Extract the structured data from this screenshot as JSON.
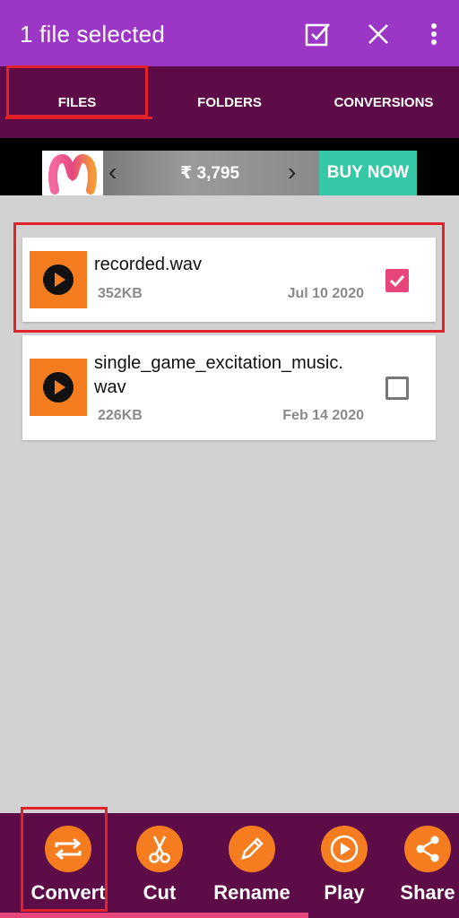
{
  "topbar": {
    "title": "1 file selected",
    "actions": [
      "select-all-icon",
      "close-icon",
      "more-vert-icon"
    ]
  },
  "tabs": [
    {
      "label": "FILES",
      "selected": true
    },
    {
      "label": "FOLDERS"
    },
    {
      "label": "CONVERSIONS"
    }
  ],
  "ad": {
    "price": "₹ 3,795",
    "cta": "BUY NOW"
  },
  "files": [
    {
      "name": "recorded.wav",
      "size": "352KB",
      "date": "Jul 10 2020",
      "checked": true
    },
    {
      "name_line1": "single_game_excitation_music.",
      "name_line2": "wav",
      "size": "226KB",
      "date": "Feb 14 2020",
      "checked": false
    }
  ],
  "bottom_actions": [
    {
      "label": "Convert",
      "icon": "convert-icon"
    },
    {
      "label": "Cut",
      "icon": "scissors-icon"
    },
    {
      "label": "Rename",
      "icon": "pencil-icon"
    },
    {
      "label": "Play",
      "icon": "play-circle-icon"
    },
    {
      "label": "Share",
      "icon": "share-icon"
    }
  ],
  "colors": {
    "topbar": "#9b36c7",
    "tabs": "#5d0c47",
    "accent": "#f57c1f",
    "checkbox": "#e8467a",
    "highlight": "#e2222a"
  }
}
